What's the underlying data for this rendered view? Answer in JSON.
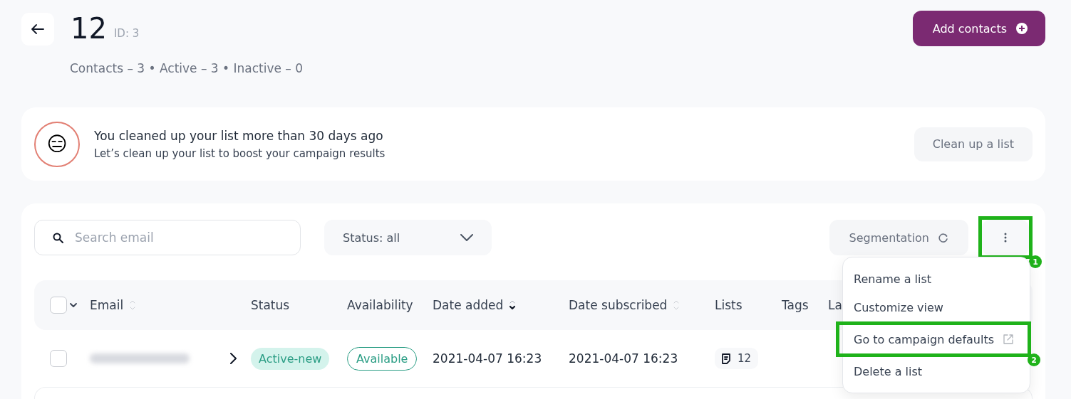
{
  "header": {
    "title": "12",
    "id_label": "ID: 3",
    "stats": "Contacts – 3 • Active – 3 • Inactive – 0",
    "add_button": "Add contacts"
  },
  "banner": {
    "title": "You cleaned up your list more than 30 days ago",
    "text": "Let’s clean up your list to boost your campaign results",
    "emoji": "😑",
    "button": "Clean up a list"
  },
  "toolbar": {
    "search": {
      "placeholder": "Search email"
    },
    "status_filter": "Status: all",
    "segmentation": "Segmentation",
    "more_button": {
      "highlighted": true,
      "badge": "1"
    }
  },
  "table": {
    "columns": [
      {
        "label": "Email",
        "sortable": true,
        "sorted": false
      },
      {
        "label": "Status"
      },
      {
        "label": "Availability"
      },
      {
        "label": "Date added",
        "sortable": true,
        "sorted": true
      },
      {
        "label": "Date subscribed",
        "sortable": true,
        "sorted": false
      },
      {
        "label": "Lists"
      },
      {
        "label": "Tags"
      },
      {
        "label": "La"
      }
    ],
    "select_all": {
      "checked": false
    },
    "rows": [
      {
        "checked": false,
        "status": "Active-new",
        "availability": "Available",
        "date_added": "2021-04-07 16:23",
        "date_subscribed": "2021-04-07 16:23",
        "lists": "12"
      }
    ]
  },
  "menu": {
    "items": [
      {
        "label": "Rename a list",
        "external": false,
        "highlighted": false
      },
      {
        "label": "Customize view",
        "external": false,
        "highlighted": false
      },
      {
        "label": "Go to campaign defaults",
        "external": true,
        "highlighted": true,
        "badge": "2"
      },
      {
        "label": "Delete a list",
        "external": false,
        "highlighted": false
      }
    ]
  }
}
